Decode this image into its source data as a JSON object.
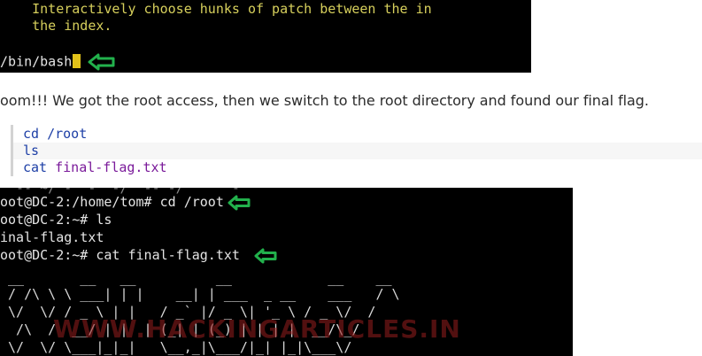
{
  "top_terminal": {
    "lines": [
      "    Interactively choose hunks of patch between the in",
      "    the index."
    ],
    "prompt": "/bin/bash"
  },
  "paragraph": "oom!!! We got the root access, then we switch to the root directory and found our final flag.",
  "code": {
    "line1_cmd": "cd",
    "line1_arg": "/root",
    "line2_cmd": "ls",
    "line3_cmd": "cat",
    "line3_arg": "final-flag.txt"
  },
  "bottom_terminal": {
    "lines": [
      "oot@DC-2:/home/tom# cd /root",
      "oot@DC-2:~# ls",
      "inal-flag.txt",
      "oot@DC-2:~# cat final-flag.txt"
    ],
    "ascii_art": [
      " __       __   __          __            __    __",
      " / /\\ \\ \\ ___| | |    __| | ___  _ __    ___   / \\",
      " \\/  \\/ / _ \\ | |   / _` |/ _ \\| '_ \\ / _ \\/  /",
      "  /\\  /  __/ | |  | (_| | (_) | | | |  __/\\_/",
      " \\/  \\/ \\___|_|_|   \\__,_|\\___/|_| |_|\\___\\/"
    ],
    "watermark": "WWW.HACKINGARTICLES.IN"
  },
  "colors": {
    "terminal_bg": "#000000",
    "terminal_yellow": "#d6cf5c",
    "arrow_green": "#22b14c"
  }
}
